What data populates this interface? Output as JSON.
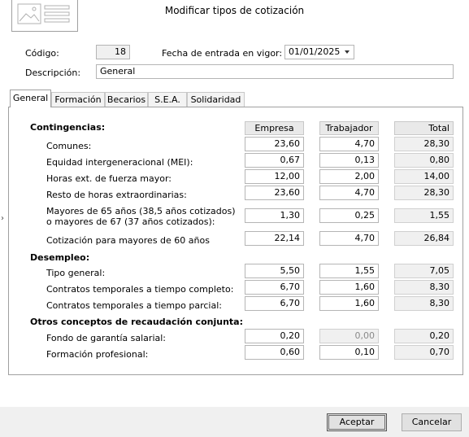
{
  "window": {
    "title": "Modificar tipos de cotización"
  },
  "header": {
    "codigo_label": "Código:",
    "codigo_value": "18",
    "fecha_label": "Fecha de entrada en vigor:",
    "fecha_value": "01/01/2025",
    "descripcion_label": "Descripción:",
    "descripcion_value": "General"
  },
  "tabs": [
    {
      "label": "General",
      "active": true
    },
    {
      "label": "Formación"
    },
    {
      "label": "Becarios"
    },
    {
      "label": "S.E.A."
    },
    {
      "label": "Solidaridad"
    }
  ],
  "columns": {
    "empresa": "Empresa",
    "trabajador": "Trabajador",
    "total": "Total"
  },
  "sections": {
    "contingencias": "Contingencias:",
    "desempleo": "Desempleo:",
    "otros": "Otros conceptos de recaudación conjunta:"
  },
  "rows": {
    "comunes": {
      "label": "Comunes:",
      "empresa": "23,60",
      "trabajador": "4,70",
      "total": "28,30"
    },
    "mei": {
      "label": "Equidad intergeneracional (MEI):",
      "empresa": "0,67",
      "trabajador": "0,13",
      "total": "0,80"
    },
    "horas_fuerza": {
      "label": "Horas ext. de fuerza mayor:",
      "empresa": "12,00",
      "trabajador": "2,00",
      "total": "14,00"
    },
    "resto_horas": {
      "label": "Resto de horas extraordinarias:",
      "empresa": "23,60",
      "trabajador": "4,70",
      "total": "28,30"
    },
    "mayores65": {
      "label_line1": "Mayores de 65 años (38,5 años cotizados)",
      "label_line2": "o mayores de 67 (37 años cotizados):",
      "empresa": "1,30",
      "trabajador": "0,25",
      "total": "1,55"
    },
    "mayores60": {
      "label": "Cotización para mayores de 60 años",
      "empresa": "22,14",
      "trabajador": "4,70",
      "total": "26,84"
    },
    "tipo_general": {
      "label": "Tipo general:",
      "empresa": "5,50",
      "trabajador": "1,55",
      "total": "7,05"
    },
    "temp_completo": {
      "label": "Contratos temporales a tiempo completo:",
      "empresa": "6,70",
      "trabajador": "1,60",
      "total": "8,30"
    },
    "temp_parcial": {
      "label": "Contratos temporales a tiempo parcial:",
      "empresa": "6,70",
      "trabajador": "1,60",
      "total": "8,30"
    },
    "fogasa": {
      "label": "Fondo de garantía salarial:",
      "empresa": "0,20",
      "trabajador": "0,00",
      "total": "0,20"
    },
    "formacion": {
      "label": "Formación profesional:",
      "empresa": "0,60",
      "trabajador": "0,10",
      "total": "0,70"
    }
  },
  "buttons": {
    "accept": "Aceptar",
    "cancel": "Cancelar"
  },
  "icons": {
    "logo": "image-placeholder-icon",
    "dropdown": "chevron-down-icon",
    "side": "chevron-right-icon"
  }
}
